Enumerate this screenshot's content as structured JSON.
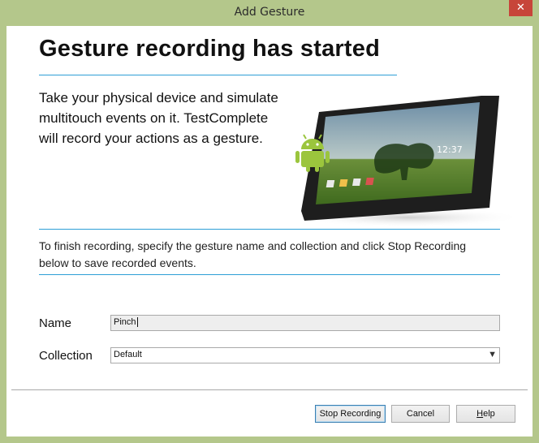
{
  "window": {
    "title": "Add Gesture",
    "close_glyph": "✕"
  },
  "header": {
    "heading": "Gesture recording has started"
  },
  "intro": {
    "line1": "Take your physical device and simulate",
    "line2": "multitouch events on it. TestComplete",
    "line3": "will record your actions as a gesture."
  },
  "illustration": {
    "clock_time": "12:37",
    "icon": "android-tablet-icon"
  },
  "instructions": {
    "line1": "To finish recording, specify the gesture name and collection and click Stop Recording",
    "line2": "below to save recorded events."
  },
  "form": {
    "name_label": "Name",
    "name_value": "Pinch",
    "collection_label": "Collection",
    "collection_value": "Default"
  },
  "buttons": {
    "stop_recording": "Stop Recording",
    "cancel": "Cancel",
    "help_rest": "elp",
    "help_mnemonic": "H"
  },
  "colors": {
    "frame": "#b4c78b",
    "accent_rule": "#2e9fd6",
    "close": "#c7453a"
  }
}
